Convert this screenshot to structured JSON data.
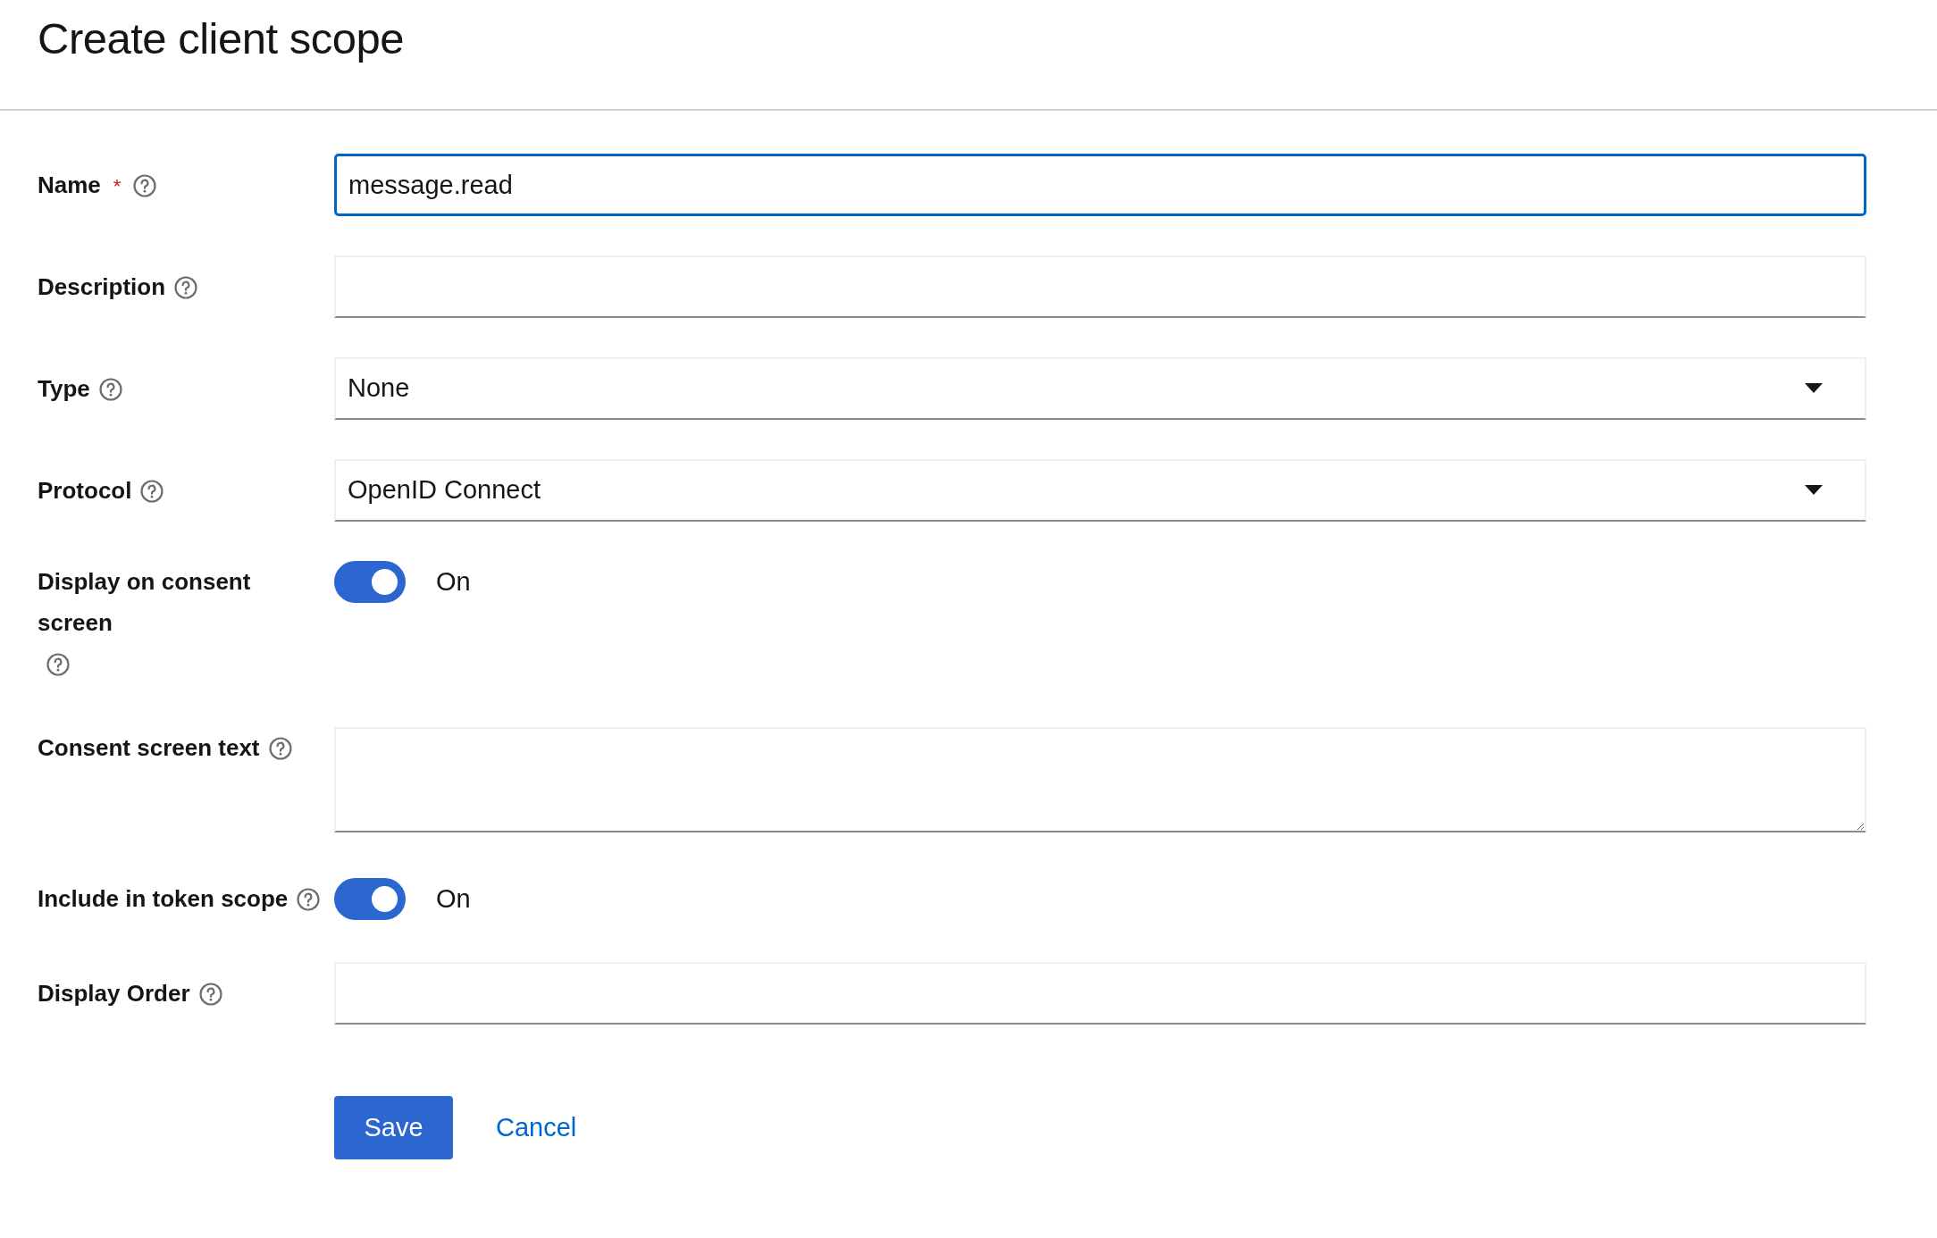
{
  "title": "Create client scope",
  "fields": [
    {
      "kind": "text",
      "label": "Name",
      "required_mark": "*",
      "focused": true,
      "value": "message.read"
    },
    {
      "kind": "text",
      "label": "Description",
      "focused": false
    },
    {
      "kind": "select",
      "label": "Type",
      "focused": false,
      "value": "None"
    },
    {
      "kind": "select",
      "label": "Protocol",
      "focused": false,
      "value": "OpenID Connect"
    },
    {
      "kind": "switch",
      "label": "Display on consent screen",
      "focused": false,
      "on": true,
      "state_text": "On"
    },
    {
      "kind": "textarea",
      "label": "Consent screen text",
      "focused": false
    },
    {
      "kind": "switch",
      "label": "Include in token scope",
      "focused": false,
      "on": true,
      "state_text": "On"
    },
    {
      "kind": "text",
      "label": "Display Order",
      "focused": false
    }
  ],
  "buttons": [
    {
      "kind": "primary",
      "label": "Save"
    },
    {
      "kind": "link",
      "label": "Cancel"
    }
  ]
}
